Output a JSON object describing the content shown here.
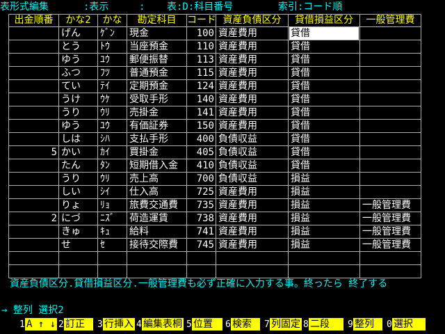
{
  "header": {
    "title": "表形式編集",
    "mode": ":表示",
    "colon": ":",
    "table": "表:D:科目番号",
    "index": "索引:コード順"
  },
  "table": {
    "columns": [
      "出金順番",
      "かな2",
      "かな",
      "勘定科目",
      "コード",
      "資産負債区分",
      "貸借損益区分",
      "一般管理費"
    ],
    "rows": [
      [
        "",
        "げん",
        "ｹﾞﾝ",
        "現金",
        "100",
        "資産費用",
        "貸借",
        ""
      ],
      [
        "",
        "とう",
        "ﾄｳ",
        "当座預金",
        "110",
        "資産費用",
        "貸借",
        ""
      ],
      [
        "",
        "ゆう",
        "ﾕｳ",
        "郵便振替",
        "113",
        "資産費用",
        "貸借",
        ""
      ],
      [
        "",
        "ふつ",
        "ﾌﾂ",
        "普通預金",
        "115",
        "資産費用",
        "貸借",
        ""
      ],
      [
        "",
        "てい",
        "ﾃｲ",
        "定期預金",
        "124",
        "資産費用",
        "貸借",
        ""
      ],
      [
        "",
        "うけ",
        "ｳｹ",
        "受取手形",
        "140",
        "資産費用",
        "貸借",
        ""
      ],
      [
        "",
        "うり",
        "ｳﾘ",
        "売掛金",
        "141",
        "資産費用",
        "貸借",
        ""
      ],
      [
        "",
        "ゆう",
        "ﾕｳ",
        "有価証券",
        "150",
        "資産費用",
        "貸借",
        ""
      ],
      [
        "",
        "しは",
        "ｼﾊ",
        "支払手形",
        "400",
        "負債収益",
        "貸借",
        ""
      ],
      [
        "5",
        "かい",
        "ｶｲ",
        "買掛金",
        "405",
        "負債収益",
        "貸借",
        ""
      ],
      [
        "",
        "たん",
        "ﾀﾝ",
        "短期借入金",
        "410",
        "負債収益",
        "貸借",
        ""
      ],
      [
        "",
        "うり",
        "ｳﾘ",
        "売上高",
        "700",
        "負債収益",
        "損益",
        ""
      ],
      [
        "",
        "しい",
        "ｼｲ",
        "仕入高",
        "725",
        "資産費用",
        "損益",
        ""
      ],
      [
        "",
        "りょ",
        "ﾘｮ",
        "旅費交通費",
        "735",
        "資産費用",
        "損益",
        "一般管理費"
      ],
      [
        "2",
        "にづ",
        "ﾆｽﾞ",
        "荷造運賃",
        "738",
        "資産費用",
        "損益",
        "一般管理費"
      ],
      [
        "",
        "きゅ",
        "ｷｭ",
        "給料",
        "741",
        "資産費用",
        "損益",
        "一般管理費"
      ],
      [
        "",
        "せ",
        "ｾ",
        "接待交際費",
        "745",
        "資産費用",
        "損益",
        "一般管理費"
      ],
      [
        "",
        "",
        "",
        "",
        "",
        "",
        "",
        ""
      ],
      [
        "",
        "",
        "",
        "",
        "",
        "",
        "",
        ""
      ]
    ]
  },
  "message": "資産負債区分.貸借損益区分.一般管理費も必ず正確に入力する事。終ったら 終了する",
  "command": "→ 整列 選択2",
  "function_keys": [
    {
      "num": "1",
      "label": "A ↑ ↓"
    },
    {
      "num": "2",
      "label": "訂正"
    },
    {
      "num": "3",
      "label": "行挿入"
    },
    {
      "num": "4",
      "label": "編集表桐"
    },
    {
      "num": "5",
      "label": "位置"
    },
    {
      "num": "6",
      "label": "検索"
    },
    {
      "num": "7",
      "label": "列固定"
    },
    {
      "num": "8",
      "label": "二段"
    },
    {
      "num": "9",
      "label": "整列"
    },
    {
      "num": "0",
      "label": "選択"
    }
  ]
}
